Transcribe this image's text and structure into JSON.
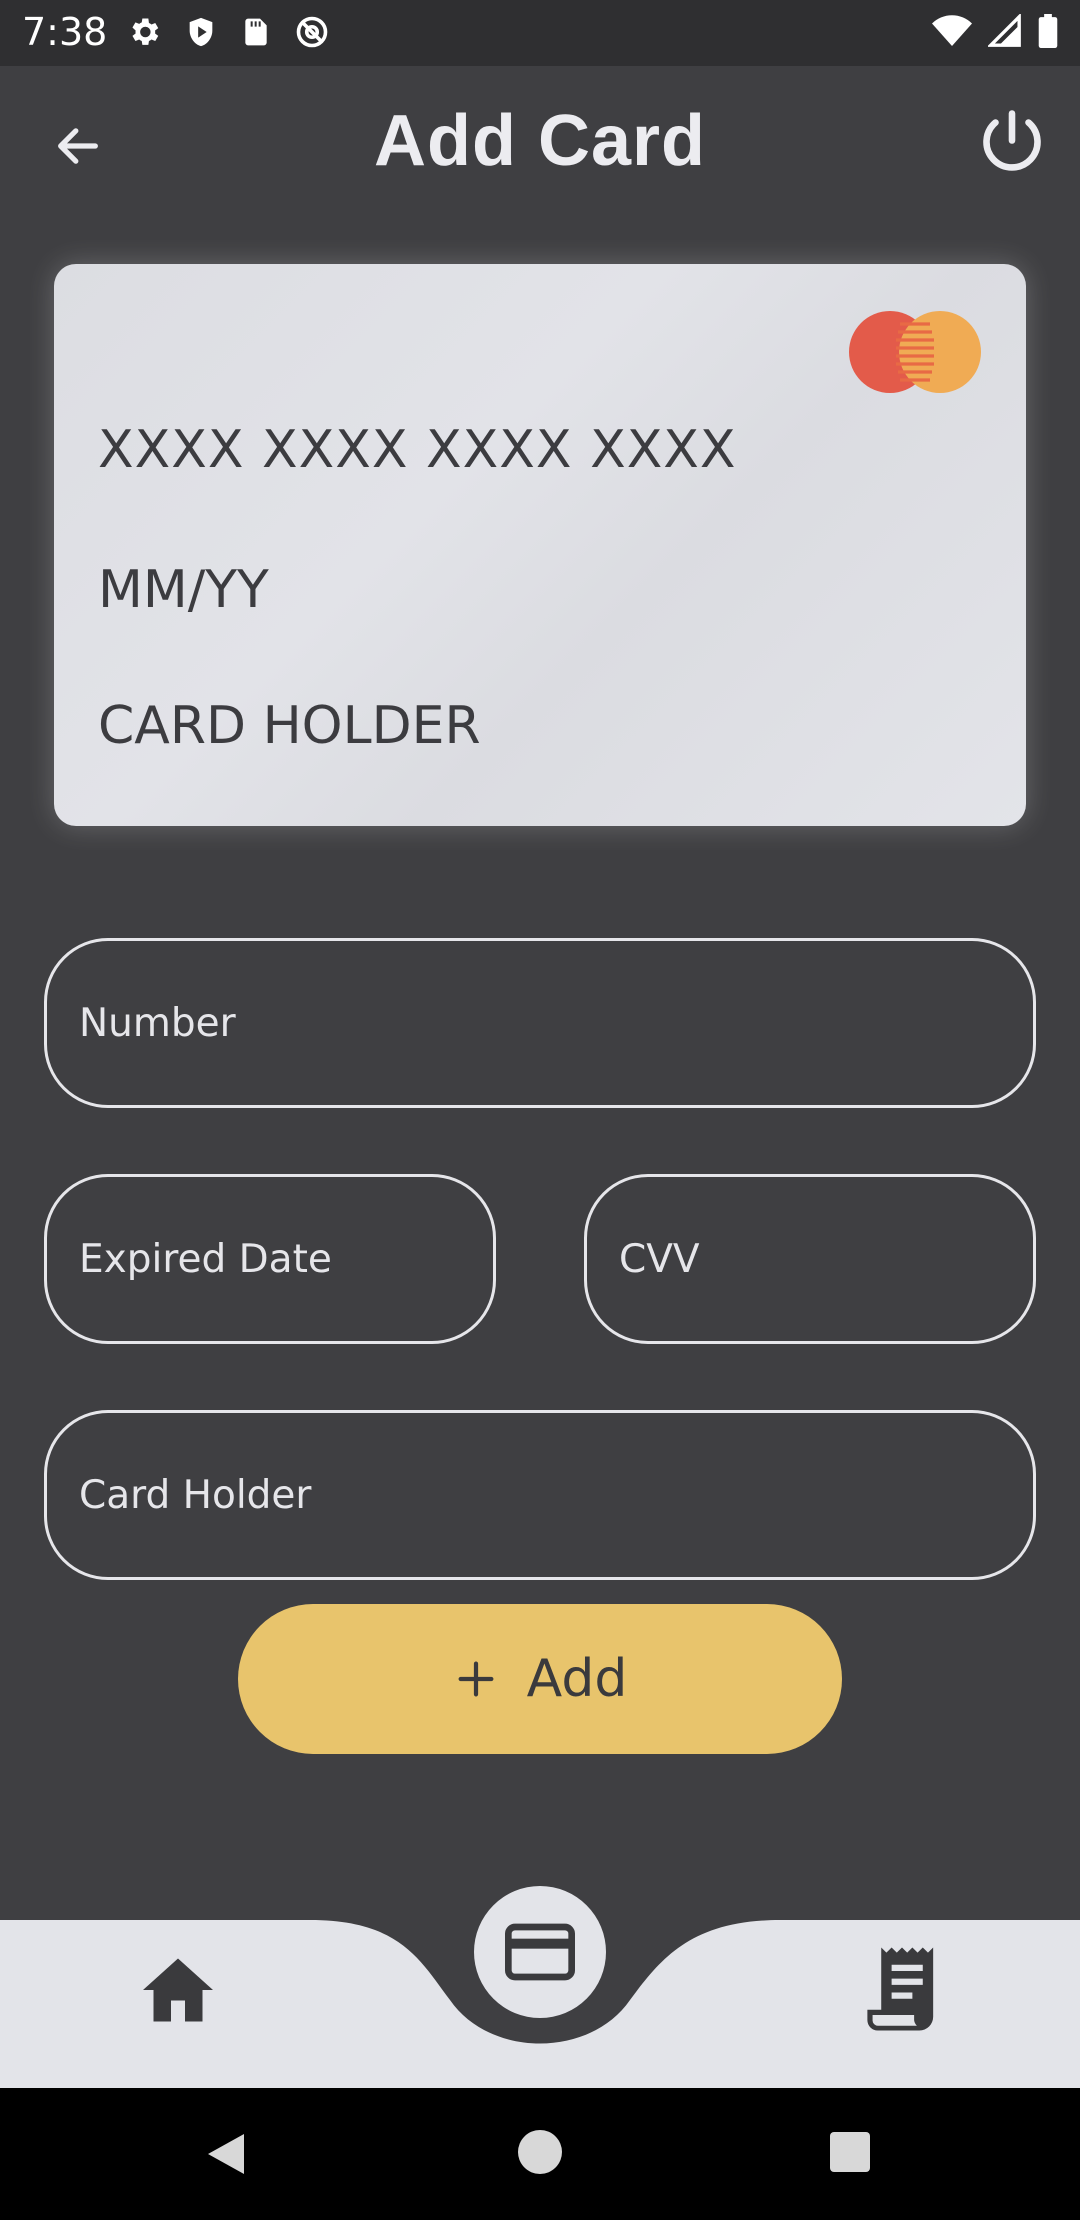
{
  "status_bar": {
    "time": "7:38",
    "left_icons": [
      "settings-icon",
      "shield-play-icon",
      "sd-card-icon",
      "at-sign-icon"
    ],
    "right_icons": [
      "wifi-icon",
      "cell-signal-icon",
      "battery-icon"
    ]
  },
  "header": {
    "title": "Add Card",
    "back_icon": "arrow-left-icon",
    "power_icon": "power-icon"
  },
  "card_preview": {
    "number": "XXXX XXXX XXXX XXXX",
    "expiry": "MM/YY",
    "holder": "CARD HOLDER",
    "brand_icon": "mastercard-logo"
  },
  "form": {
    "number_placeholder": "Number",
    "expiry_placeholder": "Expired Date",
    "cvv_placeholder": "CVV",
    "holder_placeholder": "Card Holder"
  },
  "add_button": {
    "label": "Add",
    "icon": "plus-icon"
  },
  "bottom_nav": {
    "items": [
      {
        "name": "home",
        "icon": "home-icon"
      },
      {
        "name": "cards",
        "icon": "credit-card-icon",
        "active": true
      },
      {
        "name": "receipts",
        "icon": "receipt-icon"
      }
    ]
  },
  "colors": {
    "background": "#3f3f42",
    "card": "#dddee3",
    "accent": "#e8c46c",
    "nav_bar": "#e3e4e9",
    "text_light": "#e6e6ea",
    "text_dark": "#3c3c40"
  }
}
